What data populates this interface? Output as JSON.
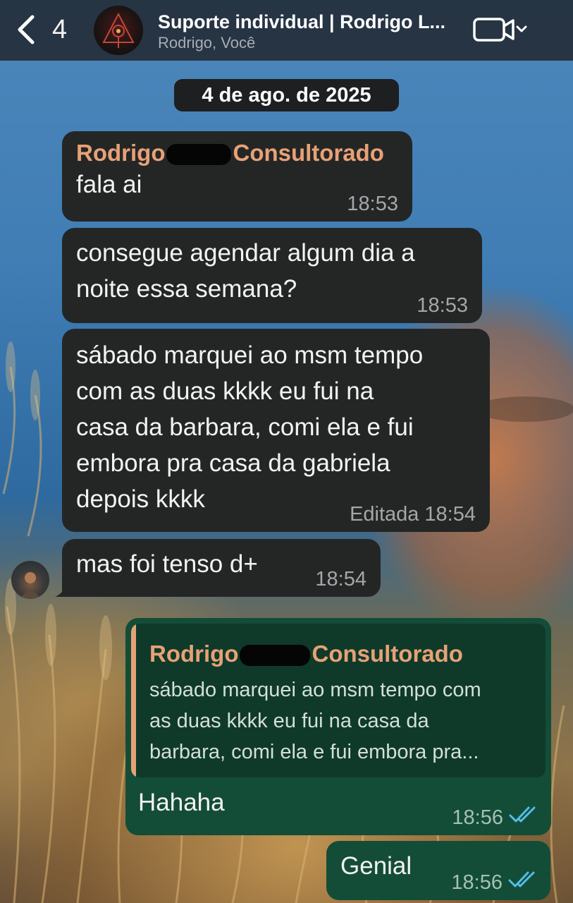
{
  "header": {
    "back_count": "4",
    "title": "Suporte individual | Rodrigo L...",
    "subtitle": "Rodrigo, Você"
  },
  "date_separator": "4 de ago. de 2025",
  "messages": [
    {
      "direction": "incoming",
      "sender_first": "Rodrigo",
      "sender_last": "Consultorado",
      "text": "fala ai",
      "time": "18:53"
    },
    {
      "direction": "incoming",
      "text_lines": [
        "consegue agendar algum dia a",
        "noite essa semana?"
      ],
      "time": "18:53"
    },
    {
      "direction": "incoming",
      "text_lines": [
        "sábado marquei ao msm tempo",
        "com as duas kkkk eu fui na",
        "casa da barbara, comi ela e fui",
        "embora pra casa da gabriela",
        "depois kkkk"
      ],
      "edited_label": "Editada",
      "time": "18:54"
    },
    {
      "direction": "incoming",
      "text": "mas foi tenso d+",
      "time": "18:54"
    },
    {
      "direction": "outgoing",
      "quote": {
        "sender_first": "Rodrigo",
        "sender_last": "Consultorado",
        "text_lines": [
          "sábado marquei ao msm tempo com",
          "as duas kkkk eu fui na casa da",
          "barbara, comi ela e fui embora pra..."
        ]
      },
      "text": "Hahaha",
      "time": "18:56",
      "status": "read"
    },
    {
      "direction": "outgoing",
      "text": "Genial",
      "time": "18:56",
      "status": "read"
    }
  ],
  "icons": {
    "back": "chevron-left-icon",
    "video": "video-camera-icon",
    "dropdown": "chevron-down-icon",
    "read_receipt": "double-check-icon"
  },
  "colors": {
    "incoming_bubble": "#242626",
    "outgoing_bubble": "#144d37",
    "sender_name": "#e7a177",
    "read_ticks": "#53bdeb",
    "header_bg": "#242e3a"
  }
}
